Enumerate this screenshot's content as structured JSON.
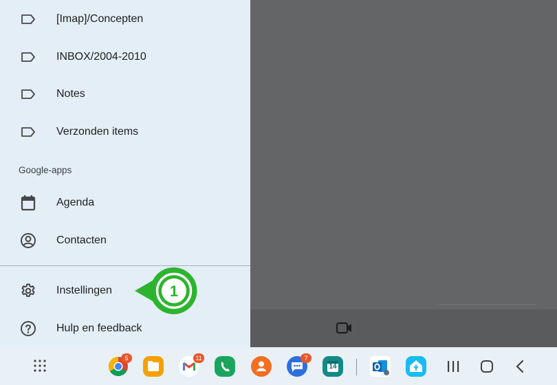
{
  "drawer": {
    "folders": [
      {
        "label": "[Imap]/Concepten",
        "icon": "label-icon"
      },
      {
        "label": "INBOX/2004-2010",
        "icon": "label-icon"
      },
      {
        "label": "Notes",
        "icon": "label-icon"
      },
      {
        "label": "Verzonden items",
        "icon": "label-icon"
      }
    ],
    "section_title": "Google-apps",
    "apps": [
      {
        "label": "Agenda",
        "icon": "calendar-icon"
      },
      {
        "label": "Contacten",
        "icon": "account-circle-icon"
      }
    ],
    "settings": {
      "label": "Instellingen",
      "icon": "gear-icon"
    },
    "help": {
      "label": "Hulp en feedback",
      "icon": "help-icon"
    }
  },
  "callout": {
    "number": "1",
    "color": "#22b14c"
  },
  "taskbar": {
    "apps": [
      {
        "name": "chrome",
        "badge": "5"
      },
      {
        "name": "files"
      },
      {
        "name": "gmail",
        "badge": "11"
      },
      {
        "name": "phone"
      },
      {
        "name": "contacts"
      },
      {
        "name": "messages",
        "badge": "7"
      },
      {
        "name": "calendar",
        "date": "14"
      },
      {
        "name": "outlook"
      },
      {
        "name": "home-assistant"
      }
    ]
  }
}
